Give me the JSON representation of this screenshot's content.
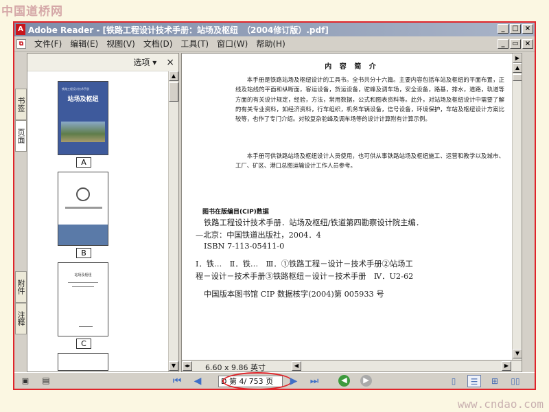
{
  "watermarks": {
    "top": "中国道桥网",
    "bottom": "www.cndao.com"
  },
  "window": {
    "app_icon": "A",
    "title": "Adobe Reader - [铁路工程设计技术手册：站场及枢纽　（2004修订版）.pdf]",
    "controls": [
      "_",
      "□",
      "×"
    ],
    "doc_controls": [
      "_",
      "▭",
      "×"
    ]
  },
  "menu": {
    "doc_icon": "pdf",
    "items": [
      "文件(F)",
      "编辑(E)",
      "视图(V)",
      "文档(D)",
      "工具(T)",
      "窗口(W)",
      "帮助(H)"
    ]
  },
  "nav_tabs": [
    "书签",
    "页面",
    "附件",
    "注释"
  ],
  "nav_panel": {
    "options_label": "选项 ▾",
    "close_label": "×",
    "thumbnails": [
      {
        "label": "A",
        "book_title": "站场及枢纽",
        "series": "铁路工程设计技术手册"
      },
      {
        "label": "B"
      },
      {
        "label": "C",
        "book_title": "站场及枢纽"
      }
    ]
  },
  "document": {
    "heading": "内 容 简 介",
    "paragraphs": [
      "本手册是铁路站场及枢纽设计的工具书。全书共分十六篇。主要内容包括车站及枢纽的平面布置，正线及站线的平面和纵断面，客运设备，货运设备，驼峰及调车场，安全设备，路基，排水，道路，轨道等方面的有关设计规定，经验，方法，常用数据，公式和图表资料等。此外，对站场及枢纽设计中需要了解的有关专业资料，如经济资料，行车组织，机务车辆设备，信号设备，环境保护，车站及枢纽设计方案比较等，也作了专门介绍。对较复杂驼峰及调车场等的设计计算附有计算示例。",
      "本手册可供铁路站场及枢纽设计人员使用，也可供从事铁路站场及枢纽施工、运营和教学以及城市、工厂、矿区、港口总图运输设计工作人员参考。"
    ],
    "cip_heading": "图书在版编目(CIP)数据",
    "cip_lines": [
      "铁路工程设计技术手册．站场及枢纽/铁道第四勘察设计院主编．",
      "—北京：中国铁道出版社，2004．4",
      "ISBN 7-113-05411-0",
      "Ⅰ．铁…　Ⅱ．铁…　Ⅲ．①铁路工程－设计－技术手册②站场工",
      "程－设计－技术手册③铁路枢纽－设计－技术手册　Ⅳ．U2-62",
      "中国版本图书馆 CIP 数据核字(2004)第 005933 号"
    ]
  },
  "status": {
    "page_size": "6.60 x 9.86 英寸",
    "page_indicator": "第 4/ 753 页",
    "page_field_prefix": "D",
    "highlight_color": "#e0242a"
  }
}
